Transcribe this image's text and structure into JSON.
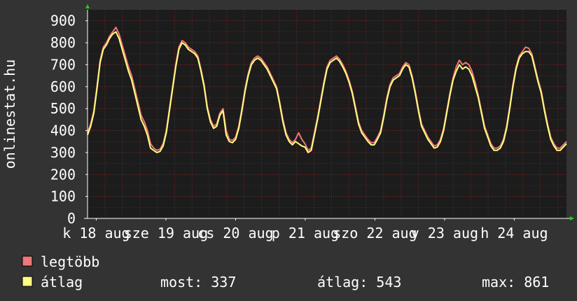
{
  "colors": {
    "background": "#333333",
    "plot_area": "#1c1c1c",
    "grid": "#7a2d2d",
    "axis": "#ffffff",
    "arrow": "#22cc22",
    "max_series": "#f07878",
    "avg_series": "#ffff80",
    "text": "#ffffff"
  },
  "chart_data": {
    "type": "line",
    "ylabel": "onlinestat.hu",
    "ylim": [
      0,
      950
    ],
    "xlim": [
      0,
      165
    ],
    "grid": true,
    "y_ticks": [
      0,
      100,
      200,
      300,
      400,
      500,
      600,
      700,
      800,
      900
    ],
    "y_tick_labels": [
      "0",
      "100",
      "200",
      "300",
      "400",
      "500",
      "600",
      "700",
      "800",
      "900"
    ],
    "x_ticks": [
      {
        "label": "k 18 aug",
        "t": 3
      },
      {
        "label": "sze 19 aug",
        "t": 27
      },
      {
        "label": "cs 20 aug",
        "t": 51
      },
      {
        "label": "p 21 aug",
        "t": 75
      },
      {
        "label": "szo 22 aug",
        "t": 99
      },
      {
        "label": "v 23 aug",
        "t": 123
      },
      {
        "label": "h 24 aug",
        "t": 147
      }
    ],
    "series": [
      {
        "name": "legtöbb",
        "color": "#f07878",
        "values": [
          390,
          430,
          490,
          600,
          720,
          780,
          800,
          830,
          850,
          870,
          840,
          790,
          740,
          690,
          650,
          590,
          530,
          470,
          440,
          400,
          340,
          320,
          310,
          315,
          340,
          400,
          500,
          600,
          700,
          780,
          810,
          800,
          780,
          770,
          760,
          740,
          680,
          610,
          510,
          450,
          420,
          430,
          480,
          500,
          400,
          360,
          355,
          370,
          420,
          500,
          590,
          660,
          710,
          730,
          740,
          730,
          710,
          690,
          660,
          630,
          600,
          530,
          450,
          390,
          360,
          345,
          360,
          390,
          360,
          340,
          310,
          320,
          390,
          460,
          540,
          620,
          690,
          720,
          730,
          740,
          725,
          700,
          670,
          630,
          580,
          510,
          440,
          400,
          380,
          360,
          345,
          345,
          370,
          400,
          470,
          550,
          610,
          640,
          650,
          660,
          690,
          710,
          700,
          650,
          580,
          500,
          430,
          400,
          370,
          350,
          330,
          335,
          360,
          410,
          490,
          570,
          640,
          690,
          720,
          700,
          710,
          700,
          670,
          620,
          560,
          490,
          420,
          380,
          340,
          320,
          320,
          330,
          360,
          420,
          510,
          610,
          690,
          740,
          760,
          780,
          775,
          750,
          690,
          630,
          580,
          500,
          430,
          370,
          340,
          320,
          320,
          335,
          350
        ]
      },
      {
        "name": "átlag",
        "color": "#ffff80",
        "values": [
          380,
          420,
          480,
          590,
          710,
          770,
          790,
          820,
          840,
          850,
          820,
          770,
          720,
          670,
          630,
          570,
          510,
          450,
          420,
          380,
          320,
          310,
          300,
          305,
          330,
          390,
          490,
          590,
          690,
          770,
          800,
          790,
          770,
          760,
          750,
          730,
          670,
          600,
          500,
          440,
          410,
          420,
          470,
          490,
          380,
          350,
          345,
          360,
          410,
          490,
          580,
          650,
          700,
          720,
          730,
          720,
          700,
          680,
          650,
          620,
          590,
          520,
          440,
          380,
          350,
          335,
          350,
          340,
          330,
          325,
          300,
          310,
          380,
          450,
          530,
          610,
          680,
          710,
          720,
          730,
          715,
          690,
          660,
          620,
          570,
          500,
          430,
          390,
          370,
          350,
          335,
          335,
          360,
          390,
          460,
          540,
          600,
          630,
          640,
          650,
          680,
          700,
          690,
          640,
          570,
          490,
          420,
          390,
          360,
          340,
          320,
          325,
          350,
          400,
          480,
          560,
          630,
          670,
          700,
          680,
          690,
          680,
          650,
          600,
          550,
          480,
          410,
          370,
          330,
          310,
          310,
          320,
          350,
          410,
          500,
          600,
          680,
          730,
          750,
          760,
          760,
          740,
          680,
          620,
          570,
          490,
          420,
          360,
          330,
          310,
          310,
          325,
          340
        ]
      }
    ]
  },
  "legend": {
    "items": [
      {
        "label": "legtöbb",
        "color": "#f07878"
      },
      {
        "label": "átlag",
        "color": "#ffff80"
      }
    ],
    "stats": {
      "current": "most: 337",
      "average": "átlag: 543",
      "max": "max: 861"
    }
  }
}
